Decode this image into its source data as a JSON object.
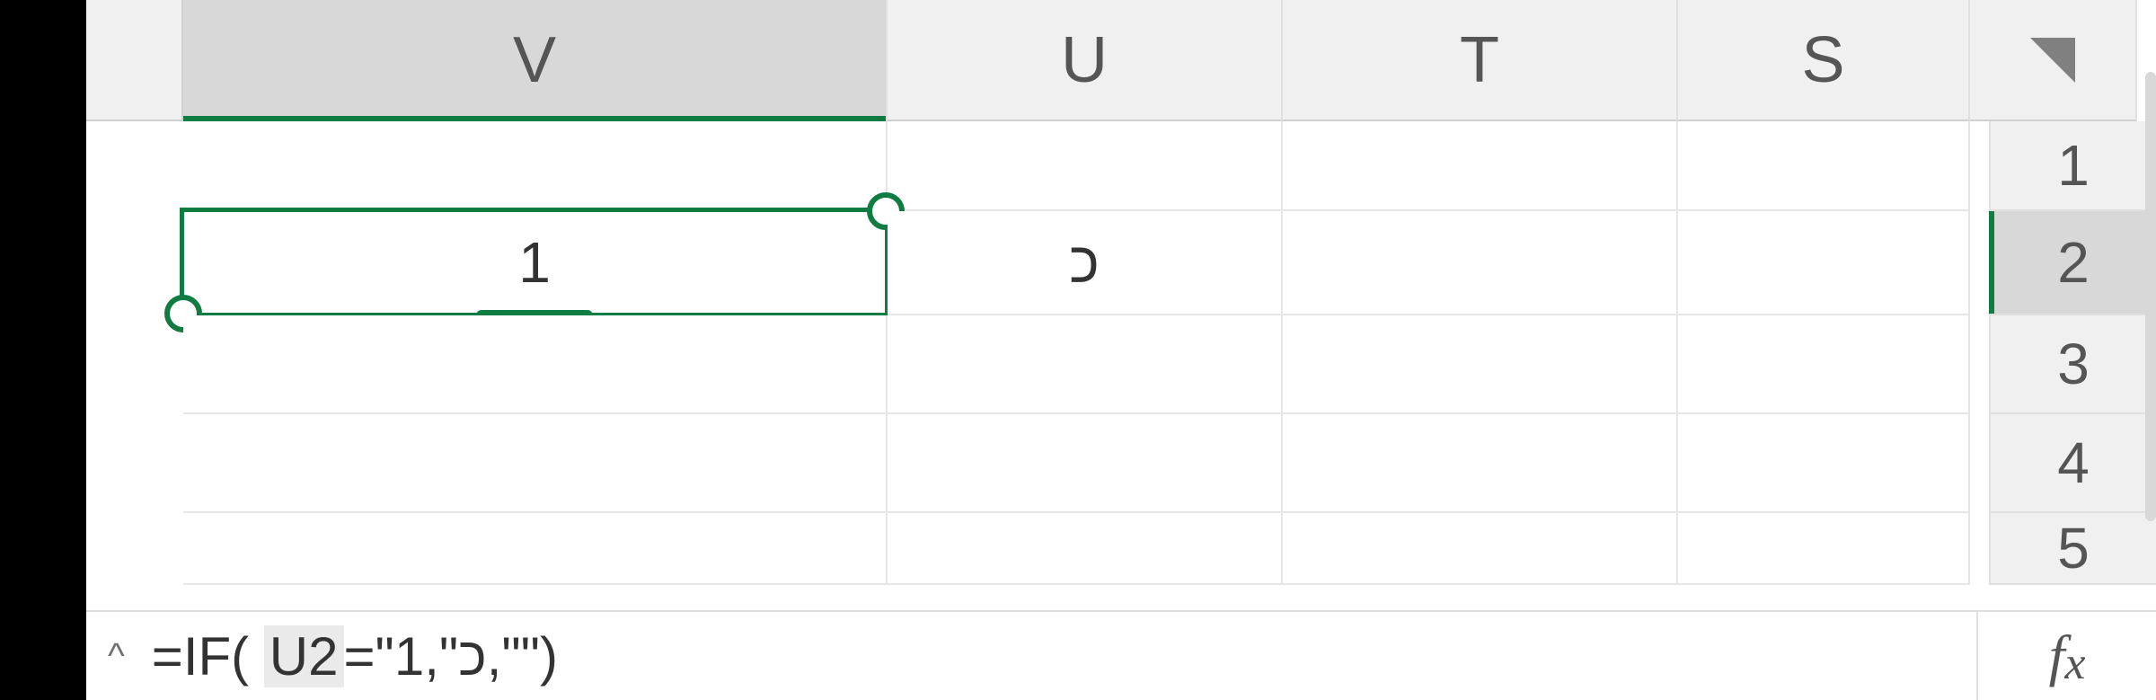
{
  "columns": {
    "V": "V",
    "U": "U",
    "T": "T",
    "S": "S"
  },
  "rows": {
    "r1": "1",
    "r2": "2",
    "r3": "3",
    "r4": "4",
    "r5": "5"
  },
  "cells": {
    "V2": "1",
    "U2": "כ"
  },
  "active_cell": "V2",
  "active_column": "V",
  "active_row": "2",
  "formula_bar": {
    "prefix": "=IF(",
    "ref": "U2",
    "suffix": " =\"כ\",1,\"\")",
    "fx_label_f": "f",
    "fx_label_x": "x"
  },
  "colors": {
    "selection": "#107c41"
  }
}
